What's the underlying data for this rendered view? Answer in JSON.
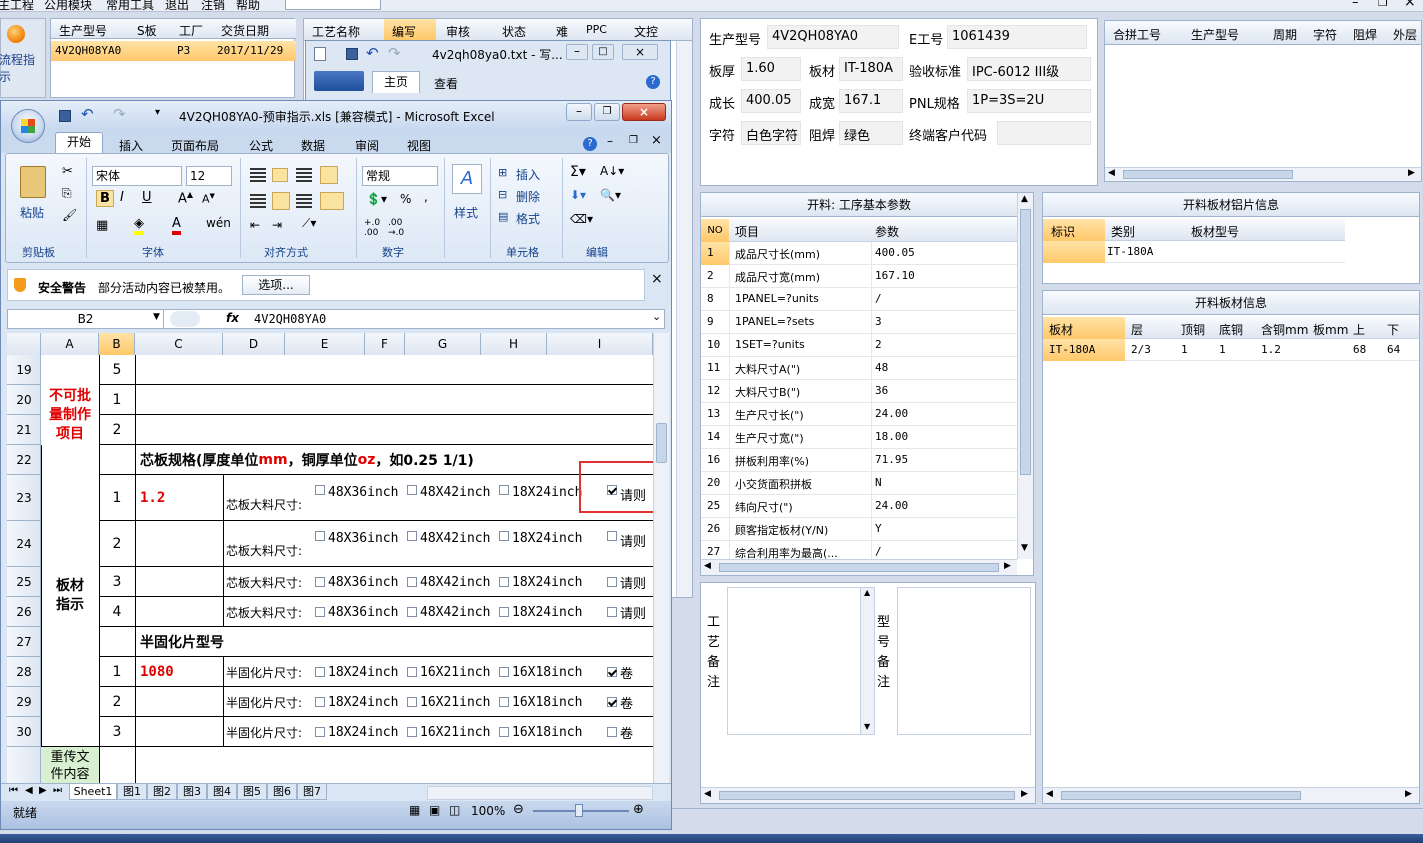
{
  "menubar": [
    "主工程",
    "公用模块",
    "常用工具",
    "退出",
    "注销",
    "帮助"
  ],
  "win_controls": {
    "min": "–",
    "restore": "❐",
    "close": "×"
  },
  "left_panel": {
    "button_label": "流程指示",
    "headers": [
      "生产型号",
      "S板",
      "工厂",
      "交货日期"
    ],
    "row": [
      "4V2QH08YA0",
      "",
      "P3",
      "2017/11/29"
    ]
  },
  "mid_panel": {
    "headers": [
      "工艺名称",
      "编写",
      "审核",
      "状态",
      "难",
      "PPC",
      "文控"
    ]
  },
  "notepad": {
    "title": "4v2qh08ya0.txt - 写...",
    "tabs": [
      "主页",
      "查看"
    ]
  },
  "excel": {
    "title": "4V2QH08YA0-预审指示.xls  [兼容模式] - Microsoft Excel",
    "tabs": [
      "开始",
      "插入",
      "页面布局",
      "公式",
      "数据",
      "审阅",
      "视图"
    ],
    "font_name": "宋体",
    "font_size": "12",
    "number_format": "常规",
    "paste": "粘贴",
    "styles": "样式",
    "insert": "插入",
    "delete": "删除",
    "format": "格式",
    "groups": [
      "剪贴板",
      "字体",
      "对齐方式",
      "数字",
      "单元格",
      "编辑"
    ],
    "security_title": "安全警告",
    "security_text": "部分活动内容已被禁用。",
    "options_btn": "选项...",
    "name_box": "B2",
    "fx": "fx",
    "formula": "4V2QH08YA0",
    "columns": [
      "A",
      "B",
      "C",
      "D",
      "E",
      "F",
      "G",
      "H",
      "I"
    ],
    "row_nums": [
      "19",
      "20",
      "21",
      "22",
      "23",
      "24",
      "25",
      "26",
      "27",
      "28",
      "29",
      "30"
    ],
    "b_vals": [
      "5",
      "1",
      "2",
      "",
      "1",
      "2",
      "3",
      "4",
      "",
      "1",
      "2",
      "3"
    ],
    "label_red": "不可批量制作项目",
    "label_board": "板材指示",
    "label_reupload": "重传文件内容",
    "core_header": "芯板规格(厚度单位",
    "core_mm": "mm",
    "core_mid": "，铜厚单位",
    "core_oz": "oz",
    "core_tail": "，如0.25 1/1)",
    "core_value": "1.2",
    "core_label": "芯板大料尺寸:",
    "core_opts": [
      "48X36inch",
      "48X42inch",
      "18X24inch"
    ],
    "core_last": "请则",
    "prepreg_header": "半固化片型号",
    "prepreg_value": "1080",
    "prepreg_label": "半固化片尺寸:",
    "prepreg_opts": [
      "18X24inch",
      "16X21inch",
      "16X18inch"
    ],
    "prepreg_last": "卷",
    "sheets": [
      "Sheet1",
      "图1",
      "图2",
      "图3",
      "图4",
      "图5",
      "图6",
      "图7"
    ],
    "status": "就绪",
    "zoom": "100%"
  },
  "info": {
    "model_label": "生产型号",
    "model": "4V2QH08YA0",
    "e_label": "E工号",
    "e": "1061439",
    "thick_label": "板厚",
    "thick": "1.60",
    "mat_label": "板材",
    "mat": "IT-180A",
    "std_label": "验收标准",
    "std": "IPC-6012 III级",
    "len_label": "成长",
    "len": "400.05",
    "wid_label": "成宽",
    "wid": "167.1",
    "pnl_label": "PNL规格",
    "pnl": "1P=3S=2U",
    "char_label": "字符",
    "char": "白色字符",
    "mask_label": "阻焊",
    "mask": "绿色",
    "cust_label": "终端客户代码",
    "cust": ""
  },
  "merge_headers": [
    "合拼工号",
    "生产型号",
    "周期",
    "字符",
    "阻焊",
    "外层"
  ],
  "params": {
    "title": "开料: 工序基本参数",
    "headers": [
      "NO",
      "项目",
      "参数"
    ],
    "rows": [
      [
        "1",
        "成品尺寸长(mm)",
        "400.05"
      ],
      [
        "2",
        "成品尺寸宽(mm)",
        "167.10"
      ],
      [
        "8",
        "1PANEL=?units",
        "/"
      ],
      [
        "9",
        "1PANEL=?sets",
        "3"
      ],
      [
        "10",
        "1SET=?units",
        "2"
      ],
      [
        "11",
        "大料尺寸A(\")",
        "48"
      ],
      [
        "12",
        "大料尺寸B(\")",
        "36"
      ],
      [
        "13",
        "生产尺寸长(\")",
        "24.00"
      ],
      [
        "14",
        "生产尺寸宽(\")",
        "18.00"
      ],
      [
        "16",
        "拼板利用率(%)",
        "71.95"
      ],
      [
        "20",
        "小交货面积拼板",
        "N"
      ],
      [
        "25",
        "纬向尺寸(\")",
        "24.00"
      ],
      [
        "26",
        "顾客指定板材(Y/N)",
        "Y"
      ],
      [
        "27",
        "综合利用率为最高(...",
        "/"
      ]
    ]
  },
  "alu": {
    "title": "开料板材铝片信息",
    "headers": [
      "标识",
      "类别",
      "板材型号"
    ],
    "row": [
      "",
      "IT-180A",
      ""
    ]
  },
  "board": {
    "title": "开料板材信息",
    "headers": [
      "板材",
      "层",
      "顶铜",
      "底铜",
      "含铜mm",
      "板mm",
      "上",
      "下"
    ],
    "row": [
      "IT-180A",
      "2/3",
      "1",
      "1",
      "1.2",
      "",
      "68",
      "64"
    ]
  },
  "notes": {
    "process": "工艺备注",
    "model": "型号备注"
  }
}
